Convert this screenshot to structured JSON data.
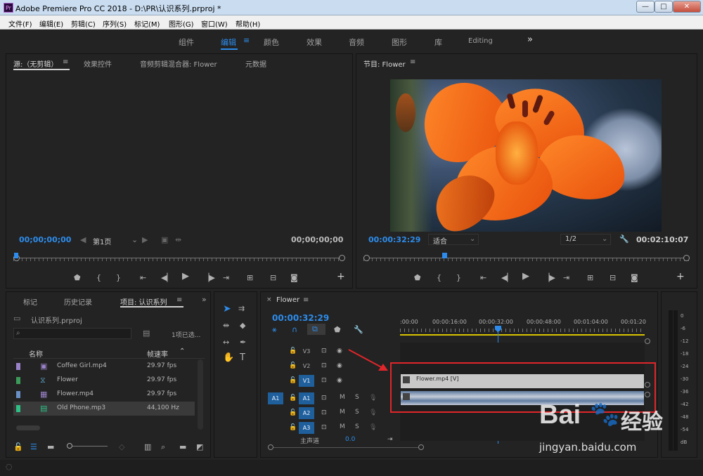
{
  "app": {
    "title": "Adobe Premiere Pro CC 2018 - D:\\PR\\认识系列.prproj *",
    "logo": "Pr",
    "min": "—",
    "max": "□",
    "close": "✕"
  },
  "menu": [
    "文件(F)",
    "编辑(E)",
    "剪辑(C)",
    "序列(S)",
    "标记(M)",
    "图形(G)",
    "窗口(W)",
    "帮助(H)"
  ],
  "workspaces": {
    "items": [
      "组件",
      "编辑",
      "颜色",
      "效果",
      "音频",
      "图形",
      "库",
      "Editing"
    ],
    "active": 1,
    "more": "»"
  },
  "source": {
    "tabs": [
      "源:（无剪辑）",
      "效果控件",
      "音频剪辑混合器: Flower",
      "元数据"
    ],
    "timecode_left": "00;00;00;00",
    "timecode_right": "00;00;00;00",
    "page": "第1页"
  },
  "program": {
    "title": "节目: Flower",
    "timecode": "00:00:32:29",
    "fit": "适合",
    "resolution": "1/2",
    "duration": "00:02:10:07"
  },
  "project": {
    "tabs": [
      "标记",
      "历史记录",
      "项目: 认识系列"
    ],
    "file": "认识系列.prproj",
    "selected": "1项已选...",
    "col_name": "名称",
    "col_rate": "帧速率",
    "items": [
      {
        "name": "Coffee Girl.mp4",
        "rate": "29.97 fps",
        "color": "#9a82c9"
      },
      {
        "name": "Flower",
        "rate": "29.97 fps",
        "color": "#3c9a5a"
      },
      {
        "name": "Flower.mp4",
        "rate": "29.97 fps",
        "color": "#6a8fc6"
      },
      {
        "name": "Old Phone.mp3",
        "rate": "44,100 Hz",
        "color": "#2fbf86"
      }
    ]
  },
  "timeline": {
    "tab": "Flower",
    "timecode": "00:00:32:29",
    "ruler": [
      ":00:00",
      "00:00:16:00",
      "00:00:32:00",
      "00:00:48:00",
      "00:01:04:00",
      "00:01:20"
    ],
    "video_tracks": [
      "V3",
      "V2",
      "V1"
    ],
    "audio_tracks": [
      "A1",
      "A2",
      "A3"
    ],
    "source_patch": "A1",
    "master": "主声道",
    "master_val": "0.0",
    "clip_label": "Flower.mp4 [V]",
    "m": "M",
    "s": "S"
  },
  "meter": {
    "labels": [
      "0",
      "-6",
      "-12",
      "-18",
      "-24",
      "-30",
      "-36",
      "-42",
      "-48",
      "-54",
      "dB"
    ]
  },
  "watermark": {
    "brand": "Bai",
    "brand2": "经验",
    "url": "jingyan.baidu.com"
  }
}
